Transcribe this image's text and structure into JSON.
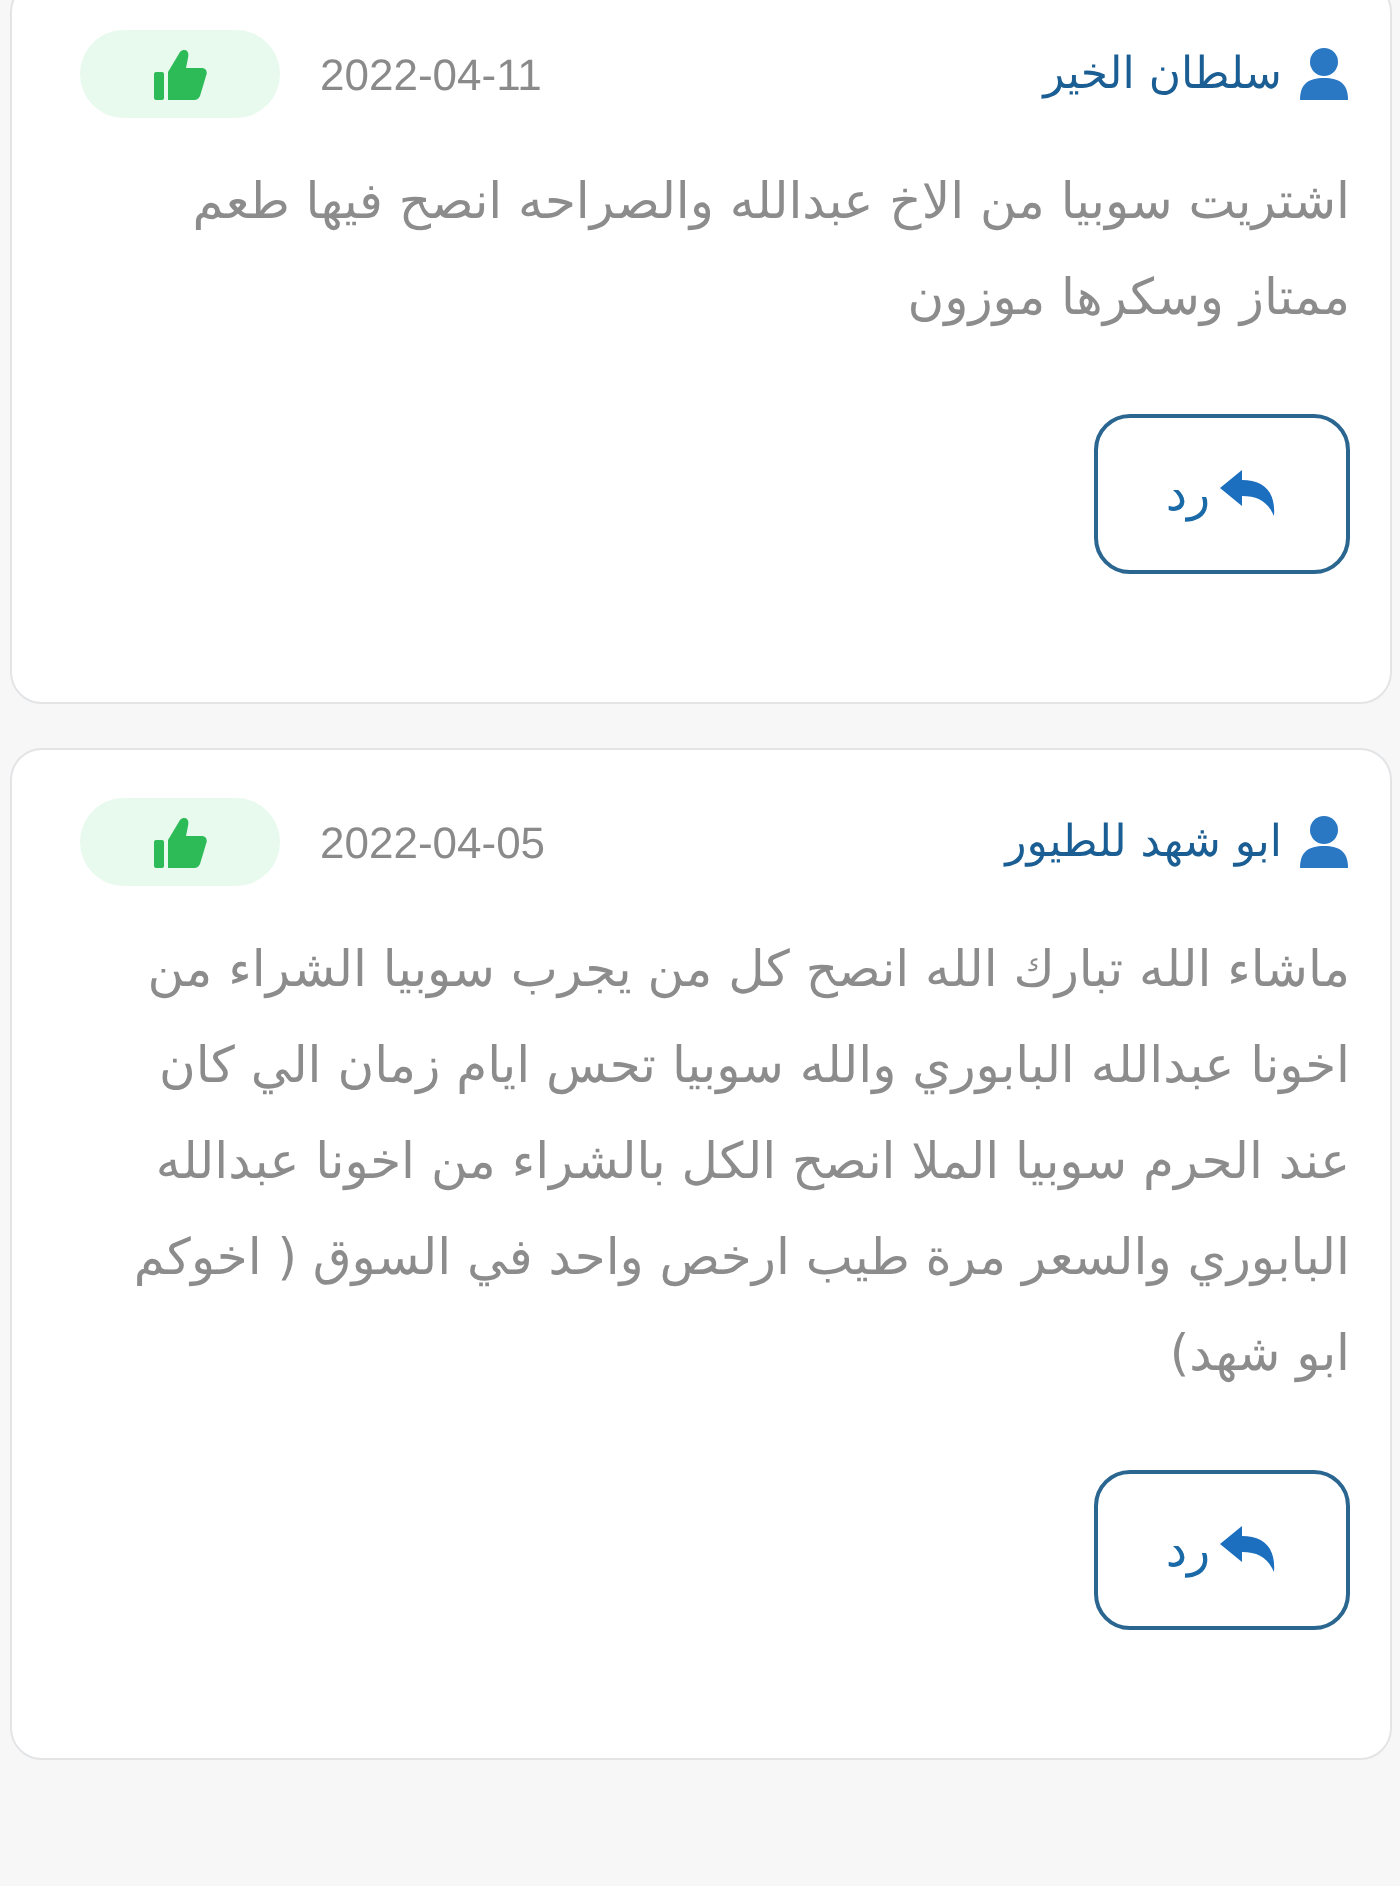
{
  "reviews": [
    {
      "author": "سلطان الخير",
      "date": "2022-04-11",
      "comment": "اشتريت سوبيا من الاخ عبدالله والصراحه انصح فيها طعم ممتاز وسكرها موزون",
      "reply_label": "رد"
    },
    {
      "author": "ابو شهد للطيور",
      "date": "2022-04-05",
      "comment": "ماشاء الله تبارك الله انصح كل من يجرب سوبيا الشراء من اخونا عبدالله البابوري والله سوبيا تحس ايام زمان الي كان عند الحرم سوبيا الملا انصح الكل بالشراء من اخونا عبدالله البابوري والسعر مرة طيب ارخص واحد في السوق ( اخوكم ابو شهد)",
      "reply_label": "رد"
    }
  ]
}
